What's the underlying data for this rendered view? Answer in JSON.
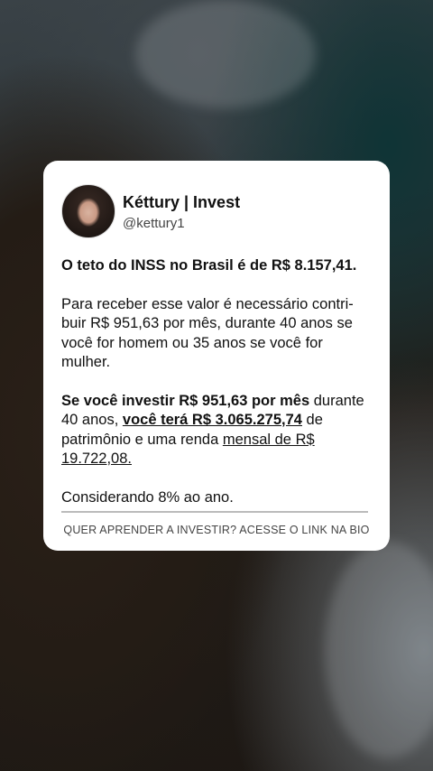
{
  "profile": {
    "name": "Kéttury | Invest",
    "handle": "@kettury1"
  },
  "post": {
    "line1": "O teto do INSS no Brasil é de R$ 8.157,41.",
    "line2": "Para receber esse valor é necessário contri-buir R$ 951,63 por mês, durante 40 anos se você for homem ou 35 anos se você for mulher.",
    "line3_bold": "Se você investir R$ 951,63 por mês",
    "line3_a": " durante 40 anos, ",
    "line3_underline_bold": "você terá R$ 3.065.275,74",
    "line3_b": " de patrimônio e uma renda ",
    "line3_underline": "mensal de R$ 19.722,08.",
    "line4": "Considerando 8% ao ano."
  },
  "footer": {
    "cta": "QUER APRENDER A INVESTIR? ACESSE O LINK NA BIO"
  }
}
